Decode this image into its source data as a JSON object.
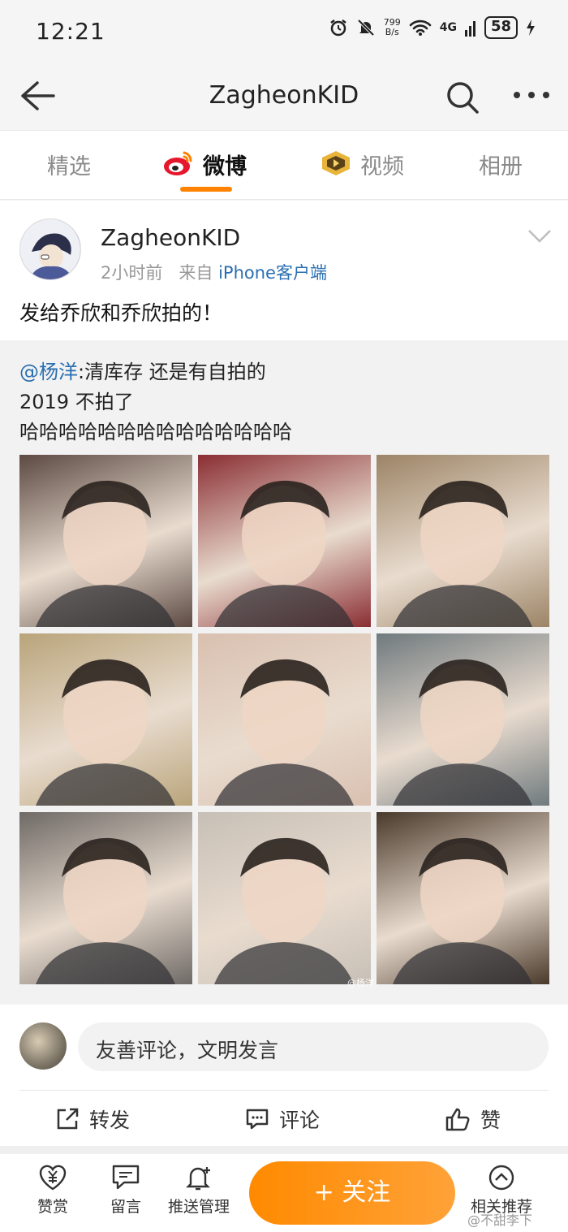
{
  "status_bar": {
    "time": "12:21",
    "net_speed_value": "799",
    "net_speed_unit": "B/s",
    "network": "4G",
    "battery": "58"
  },
  "nav": {
    "title": "ZagheonKID",
    "back_icon": "back-arrow-icon",
    "search_icon": "search-icon",
    "more_icon": "more-icon"
  },
  "tabs": [
    {
      "label": "精选",
      "active": false
    },
    {
      "label": "微博",
      "active": true,
      "icon": "weibo-logo-icon"
    },
    {
      "label": "视频",
      "active": false,
      "icon": "video-icon"
    },
    {
      "label": "相册",
      "active": false
    }
  ],
  "post": {
    "username": "ZagheonKID",
    "time_ago": "2小时前",
    "source_prefix": "来自",
    "source": "iPhone客户端",
    "text": "发给乔欣和乔欣拍的！"
  },
  "repost": {
    "mention": "@杨洋",
    "line1_rest": ":清库存 还是有自拍的",
    "line2": "2019 不拍了",
    "line3": "哈哈哈哈哈哈哈哈哈哈哈哈哈哈",
    "image_watermark": "@杨洋",
    "photos": [
      {
        "tone": "#5c4a43"
      },
      {
        "tone": "#8a2e33"
      },
      {
        "tone": "#9c8466"
      },
      {
        "tone": "#b9a47a"
      },
      {
        "tone": "#d9c0b0"
      },
      {
        "tone": "#707a7e"
      },
      {
        "tone": "#6f6a66"
      },
      {
        "tone": "#c7bfb6"
      },
      {
        "tone": "#4a3a2c"
      }
    ]
  },
  "comment": {
    "placeholder": "友善评论，文明发言"
  },
  "actions": {
    "repost": "转发",
    "comment": "评论",
    "like": "赞"
  },
  "bottom_bar": {
    "reward": "赞赏",
    "message": "留言",
    "push": "推送管理",
    "follow": "+ 关注",
    "related": "相关推荐"
  },
  "watermark": "@不甜李下",
  "colors": {
    "accent": "#ff8200",
    "link": "#2a6fb2"
  }
}
